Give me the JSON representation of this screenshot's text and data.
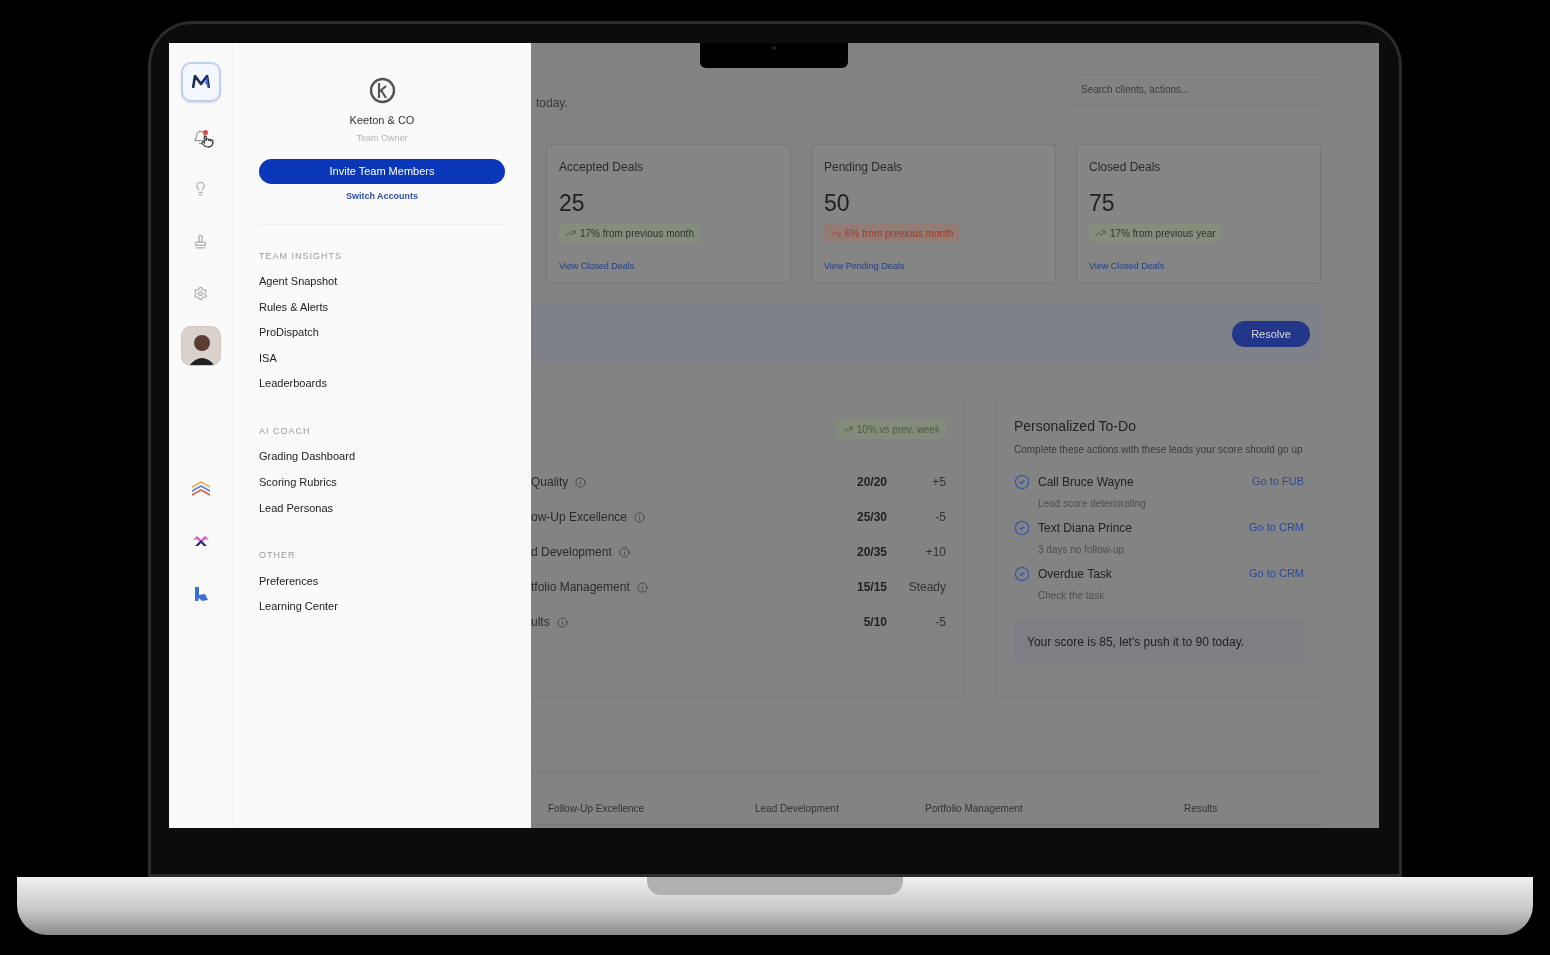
{
  "rail": [
    {
      "kind": "logo",
      "selected": true
    },
    {
      "kind": "bell",
      "selected": false,
      "notification": true
    },
    {
      "kind": "bulb",
      "selected": false
    },
    {
      "kind": "stamp",
      "selected": false
    },
    {
      "kind": "settings",
      "selected": false
    },
    {
      "kind": "avatar",
      "selected": false
    },
    {
      "kind": "app_stack",
      "selected": false
    },
    {
      "kind": "app_wing",
      "selected": false
    },
    {
      "kind": "app_k",
      "selected": false
    }
  ],
  "drawer": {
    "account": {
      "name": "Keeton & CO",
      "role": "Team Owner"
    },
    "invite_button": "Invite Team Members",
    "switch_link": "Switch Accounts",
    "sections": [
      {
        "title": "TEAM INSIGHTS",
        "items": [
          "Agent Snapshot",
          "Rules & Alerts",
          "ProDispatch",
          "ISA",
          "Leaderboards"
        ]
      },
      {
        "title": "AI COACH",
        "items": [
          "Grading Dashboard",
          "Scoring Rubrics",
          "Lead Personas"
        ]
      },
      {
        "title": "OTHER",
        "items": [
          "Preferences",
          "Learning Center"
        ]
      }
    ]
  },
  "main": {
    "greeting": "today.",
    "search": {
      "placeholder": "Search clients, actions..."
    },
    "stat_cards": [
      {
        "title": "Accepted Deals",
        "value": "25",
        "change": "17% from previous month",
        "kind": "up",
        "link": "View Closed Deals"
      },
      {
        "title": "Pending Deals",
        "value": "50",
        "change": "6% from previous month",
        "kind": "down",
        "link": "View Pending Deals"
      },
      {
        "title": "Closed Deals",
        "value": "75",
        "change": "17% from previous year",
        "kind": "up",
        "link": "View Closed Deals"
      }
    ],
    "banner": {
      "button": "Resolve"
    },
    "score_panel": {
      "badge": "10% vs prev. week",
      "rows": [
        {
          "label": "Quality",
          "score": "20/20",
          "delta": "+5"
        },
        {
          "label": "ow-Up Excellence",
          "score": "25/30",
          "delta": "-5"
        },
        {
          "label": "d Development",
          "score": "20/35",
          "delta": "+10"
        },
        {
          "label": "tfolio Management",
          "score": "15/15",
          "delta": "Steady"
        },
        {
          "label": "ults",
          "score": "5/10",
          "delta": "-5"
        }
      ]
    },
    "todo": {
      "title": "Personalized To-Do",
      "description": "Complete these actions with these leads your score should go up",
      "items": [
        {
          "title": "Call Bruce Wayne",
          "note": "Lead score deteriorating",
          "link": "Go to FUB",
          "checked": true
        },
        {
          "title": "Text Diana Prince",
          "note": "3 days no follow-up",
          "link": "Go to CRM",
          "checked": true
        },
        {
          "title": "Overdue Task",
          "note": "Check the task",
          "link": "Go to CRM",
          "checked": true
        }
      ],
      "score_message": "Your score is 85, let's push it to 90 today."
    },
    "bottom_tabs": [
      "Follow-Up Excellence",
      "Lead Development",
      "Portfolio Management",
      "Results"
    ]
  }
}
